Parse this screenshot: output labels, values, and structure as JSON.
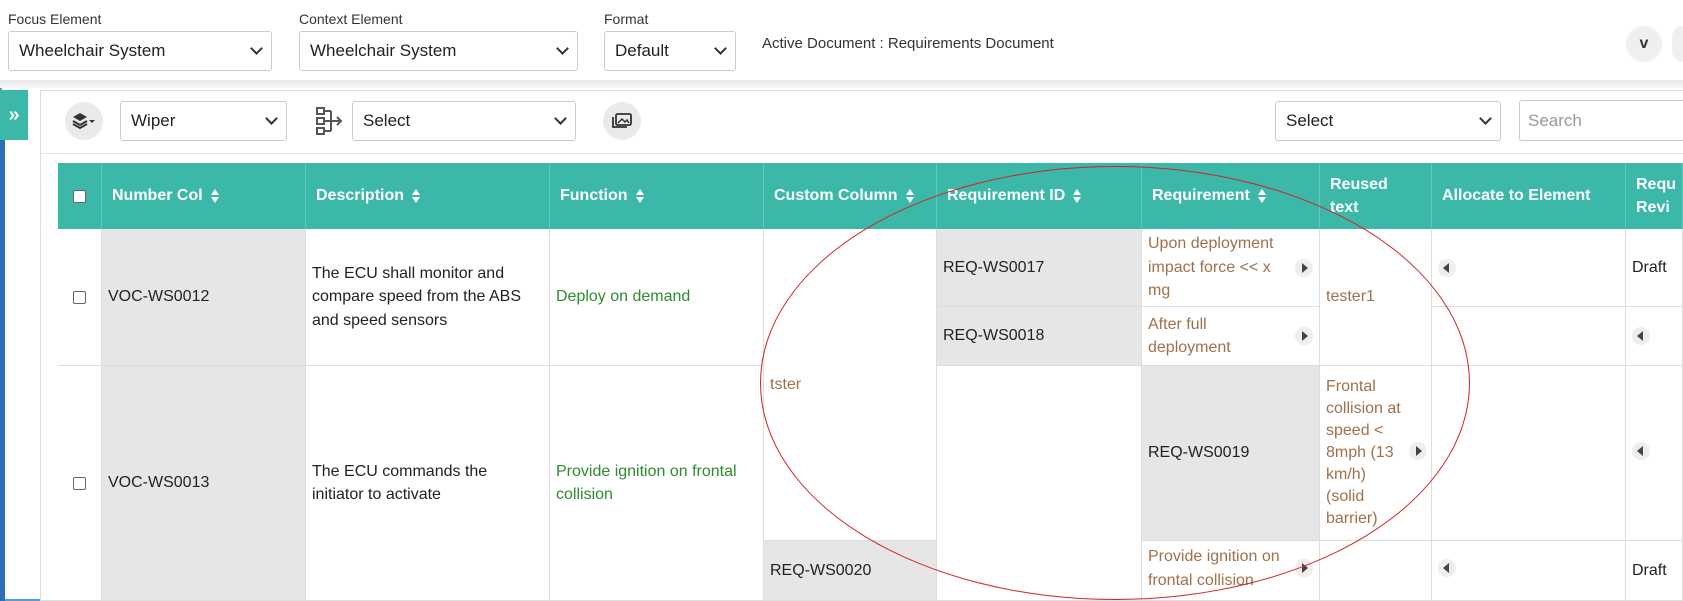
{
  "header": {
    "focus_label": "Focus Element",
    "focus_value": "Wheelchair System",
    "context_label": "Context Element",
    "context_value": "Wheelchair System",
    "format_label": "Format",
    "format_value": "Default",
    "active_document": "Active Document : Requirements Document",
    "user_badge": "v"
  },
  "toolbar": {
    "layer_select": "Wiper",
    "hierarchy_select": "Select",
    "right_select": "Select",
    "search_placeholder": "Search"
  },
  "colors": {
    "header_bg": "#3bb8a8",
    "accent_blue": "#2e6fb5",
    "link_brown": "#a0704a",
    "green_text": "#2e8b2e",
    "annotation_red": "#d42222"
  },
  "table": {
    "columns": [
      "Number Col",
      "Description",
      "Function",
      "Custom Column",
      "Requirement ID",
      "Requirement",
      "Reused text",
      "Allocate to Element",
      "Requ Revi"
    ],
    "rows": [
      {
        "number": "VOC-WS0012",
        "description": "The ECU shall monitor and compare speed from the ABS and speed sensors",
        "function": "Deploy on demand",
        "requirements": [
          {
            "id": "REQ-WS0017",
            "text": "Upon deployment impact force << x mg",
            "review": "Draft"
          },
          {
            "id": "REQ-WS0018",
            "text": "After full deployment",
            "review": ""
          }
        ],
        "reused": "tester1"
      },
      {
        "number": "VOC-WS0013",
        "description": "The ECU commands the initiator to activate",
        "function": "Provide ignition on frontal collision",
        "custom": "tster",
        "requirements": [
          {
            "id": "REQ-WS0019",
            "text": "Frontal collision at speed < 8mph (13 km/h) (solid barrier)"
          },
          {
            "id": "REQ-WS0020",
            "text": "Provide ignition on frontal collision",
            "review": "Draft"
          }
        ]
      }
    ]
  }
}
